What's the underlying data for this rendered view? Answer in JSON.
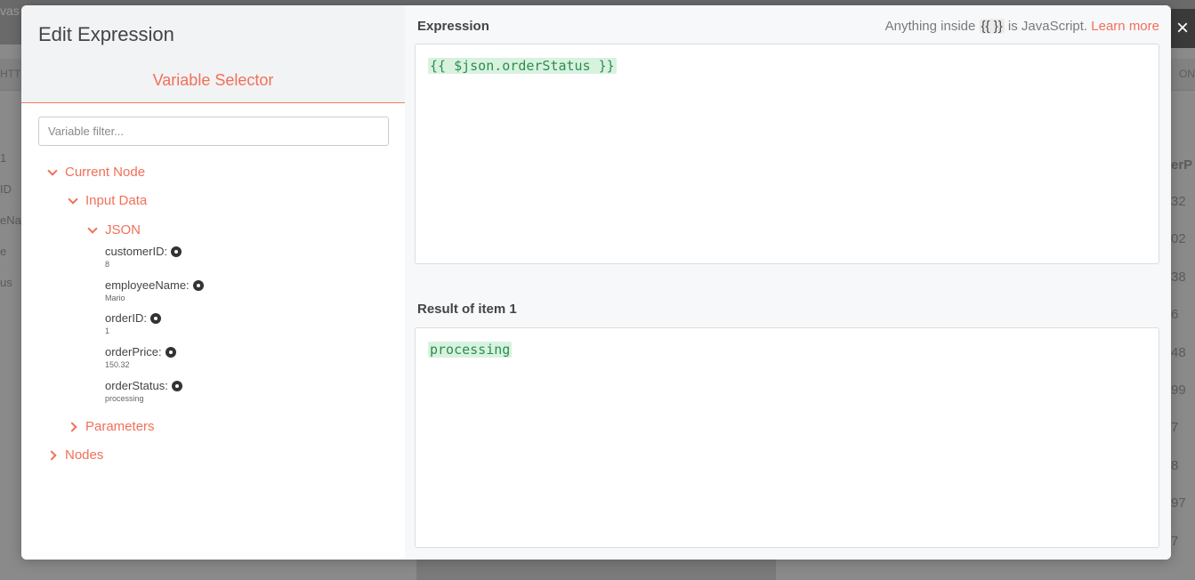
{
  "background": {
    "title_fragment": "vas",
    "strip_left": "HTTI",
    "strip_right": "ON",
    "left_labels": [
      "1",
      "ID",
      "eNar",
      "e",
      "us"
    ],
    "right_header": "erP",
    "right_values": [
      "32",
      "02",
      "38",
      "6",
      "48",
      "99",
      "7",
      "8",
      "97",
      "7"
    ]
  },
  "modal": {
    "title": "Edit Expression",
    "tab_label": "Variable Selector",
    "filter_placeholder": "Variable filter...",
    "tree": {
      "current_node": "Current Node",
      "input_data": "Input Data",
      "json": "JSON",
      "variables": [
        {
          "name": "customerID:",
          "value": "8"
        },
        {
          "name": "employeeName:",
          "value": "Mario"
        },
        {
          "name": "orderID:",
          "value": "1"
        },
        {
          "name": "orderPrice:",
          "value": "150.32"
        },
        {
          "name": "orderStatus:",
          "value": "processing"
        }
      ],
      "parameters": "Parameters",
      "nodes": "Nodes"
    },
    "expression_label": "Expression",
    "hint_prefix": "Anything inside",
    "hint_code": "{{ }}",
    "hint_suffix": "is JavaScript.",
    "learn_more": "Learn more",
    "expression": "{{ $json.orderStatus }}",
    "result_label": "Result of item 1",
    "result": "processing"
  },
  "close_icon_glyph": "×",
  "colors": {
    "accent": "#f1705a",
    "code_green": "#2a8f4b",
    "code_bg": "#d9f2e0"
  }
}
